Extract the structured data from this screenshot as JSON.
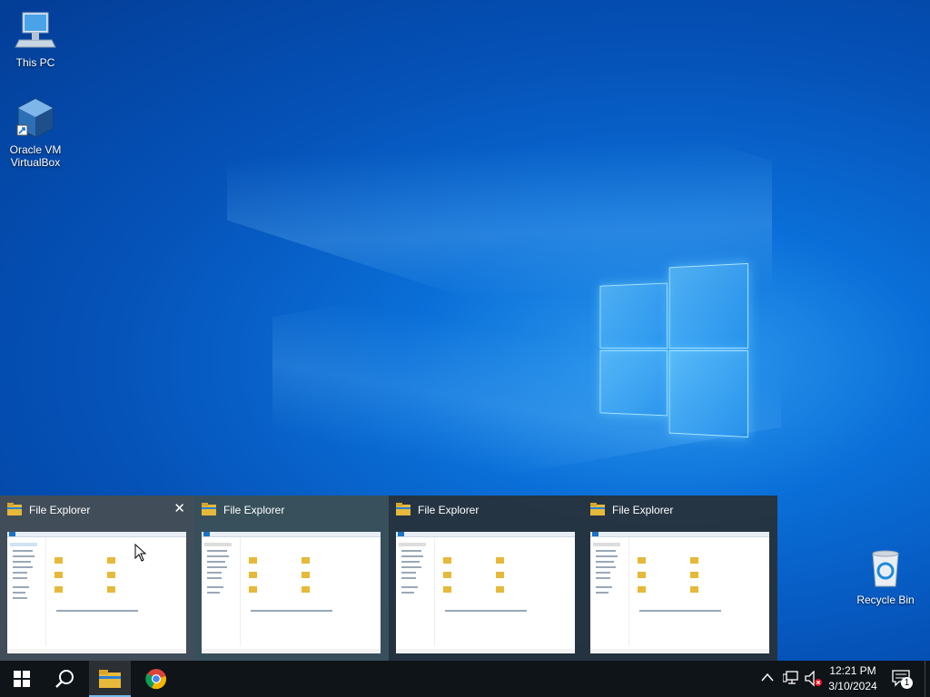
{
  "desktop": {
    "icons": [
      {
        "label": "This PC",
        "icon": "computer-icon"
      },
      {
        "label": "Oracle VM VirtualBox",
        "icon": "virtualbox-icon"
      },
      {
        "label": "Recycle Bin",
        "icon": "recycle-bin-icon"
      }
    ]
  },
  "thumbnails": [
    {
      "title": "File Explorer",
      "close": "✕"
    },
    {
      "title": "File Explorer"
    },
    {
      "title": "File Explorer"
    },
    {
      "title": "File Explorer"
    }
  ],
  "taskbar": {
    "start": "start-icon",
    "search": "search-icon",
    "apps": [
      "file-explorer-icon",
      "chrome-icon"
    ]
  },
  "tray": {
    "time": "12:21 PM",
    "date": "3/10/2024",
    "notifications": "1"
  },
  "colors": {
    "taskbar": "#0f1418",
    "accent": "#76b9ed",
    "desktop": "#0a6fd8"
  }
}
